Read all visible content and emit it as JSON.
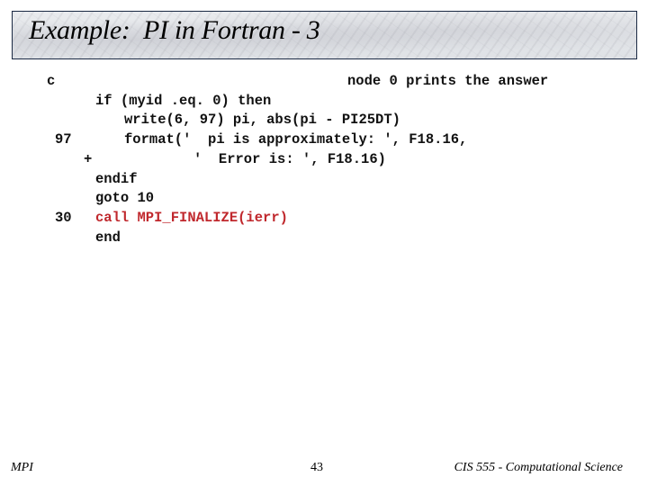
{
  "slide": {
    "title": "Example:  PI in Fortran - 3",
    "code": {
      "comment_marker": "c",
      "comment_text": "node 0 prints the answer",
      "lines": [
        {
          "label": "",
          "text": "if (myid .eq. 0) then"
        },
        {
          "label": "",
          "text": "write(6, 97) pi, abs(pi - PI25DT)"
        },
        {
          "label": "97",
          "text": "format('  pi is approximately: ', F18.16,"
        },
        {
          "label": "+",
          "text": "'  Error is: ', F18.16)"
        },
        {
          "label": "",
          "text": "endif"
        },
        {
          "label": "",
          "text": "goto 10"
        },
        {
          "label": "30",
          "text": "call MPI_FINALIZE(ierr)"
        },
        {
          "label": "",
          "text": "end"
        }
      ],
      "highlight_color": "#c0282d"
    },
    "footer": {
      "left": "MPI",
      "page_number": "43",
      "right": "CIS 555 - Computational Science"
    }
  }
}
